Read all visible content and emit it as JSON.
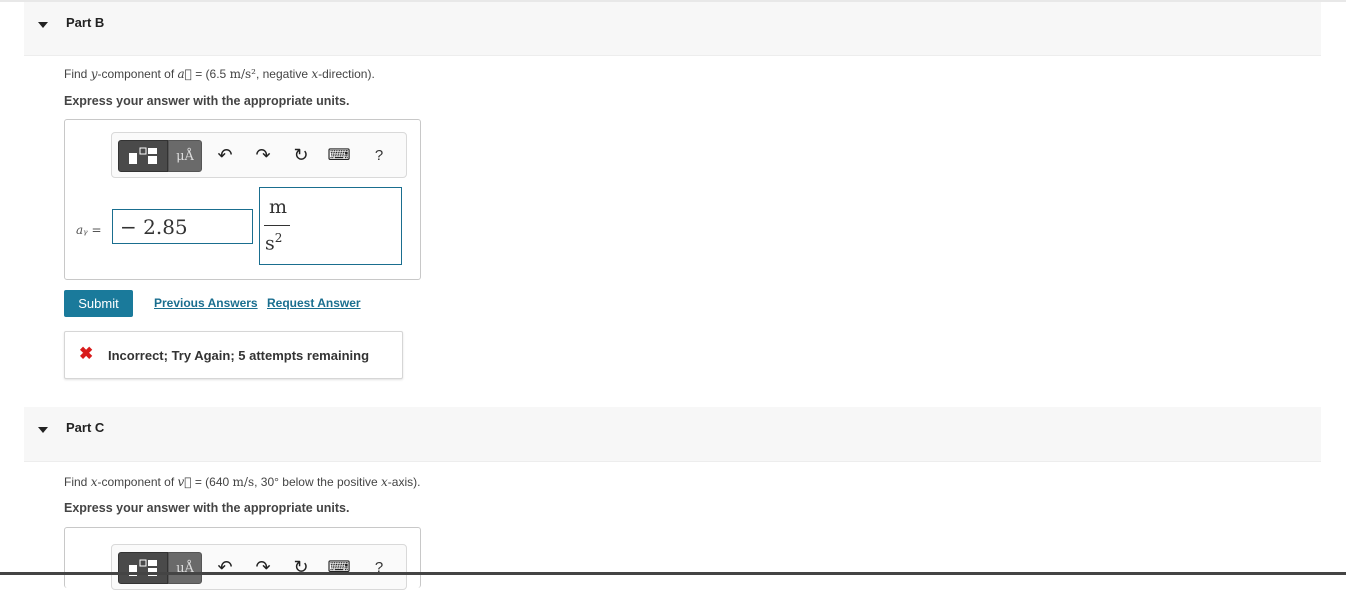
{
  "partB": {
    "title": "Part B",
    "question": {
      "prefix": "Find ",
      "var": "y",
      "mid": "-component of ",
      "vec": "a⃗",
      "eq": " = (6.5 ",
      "unit": "m/s²",
      "rest": ", negative ",
      "var2": "x",
      "suffix": "-direction)."
    },
    "instruction": "Express your answer with the appropriate units.",
    "toolbar": {
      "mu_label": "μÅ",
      "undo_icon": "↶",
      "redo_icon": "↷",
      "reset_icon": "↻",
      "keyboard_icon": "⌨",
      "help_label": "?"
    },
    "var_label": "aᵧ =",
    "answer_value": "− 2.85",
    "unit_numerator": "m",
    "unit_denominator": "s",
    "unit_exponent": "2",
    "submit_label": "Submit",
    "previous_answers_label": "Previous Answers",
    "request_answer_label": "Request Answer",
    "feedback": {
      "icon": "✖",
      "text": "Incorrect; Try Again; 5 attempts remaining",
      "color": "#d81b1b"
    }
  },
  "partC": {
    "title": "Part C",
    "question": {
      "prefix": "Find ",
      "var": "x",
      "mid": "-component of ",
      "vec": "v⃗",
      "eq": " = (640 ",
      "unit": "m/s",
      "rest": ", 30° below the positive ",
      "var2": "x",
      "suffix": "-axis)."
    },
    "instruction": "Express your answer with the appropriate units.",
    "toolbar": {
      "mu_label": "μÅ",
      "undo_icon": "↶",
      "redo_icon": "↷",
      "reset_icon": "↻",
      "keyboard_icon": "⌨",
      "help_label": "?"
    }
  },
  "colors": {
    "accent": "#1a7a9b",
    "link": "#1a6e8f",
    "error": "#d81b1b"
  }
}
